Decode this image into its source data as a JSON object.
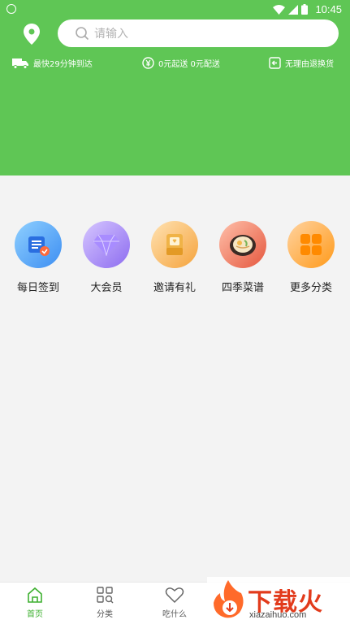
{
  "status_bar": {
    "time": "10:45"
  },
  "search": {
    "placeholder": "请输入"
  },
  "features": [
    {
      "icon": "truck-icon",
      "label": "最快29分钟到达"
    },
    {
      "icon": "yuan-icon",
      "label": "0元起送 0元配送"
    },
    {
      "icon": "return-icon",
      "label": "无理由退换货"
    }
  ],
  "categories": [
    {
      "label": "每日签到",
      "icon": "calendar-check-icon",
      "color": "#3d8ef2"
    },
    {
      "label": "大会员",
      "icon": "diamond-icon",
      "color": "#8d6cf0"
    },
    {
      "label": "邀请有礼",
      "icon": "invitation-card-icon",
      "color": "#f5a33c"
    },
    {
      "label": "四季菜谱",
      "icon": "noodle-bowl-icon",
      "color": "#e5573e"
    },
    {
      "label": "更多分类",
      "icon": "grid-icon",
      "color": "#ff9a1a"
    }
  ],
  "bottom_nav": [
    {
      "label": "首页",
      "icon": "home-icon",
      "active": true
    },
    {
      "label": "分类",
      "icon": "category-icon",
      "active": false
    },
    {
      "label": "吃什么",
      "icon": "heart-icon",
      "active": false
    }
  ],
  "watermark": {
    "title": "下载火",
    "url": "xiazaihuo.com"
  },
  "colors": {
    "brand_green": "#5fc655",
    "active_tab": "#3eb030"
  }
}
